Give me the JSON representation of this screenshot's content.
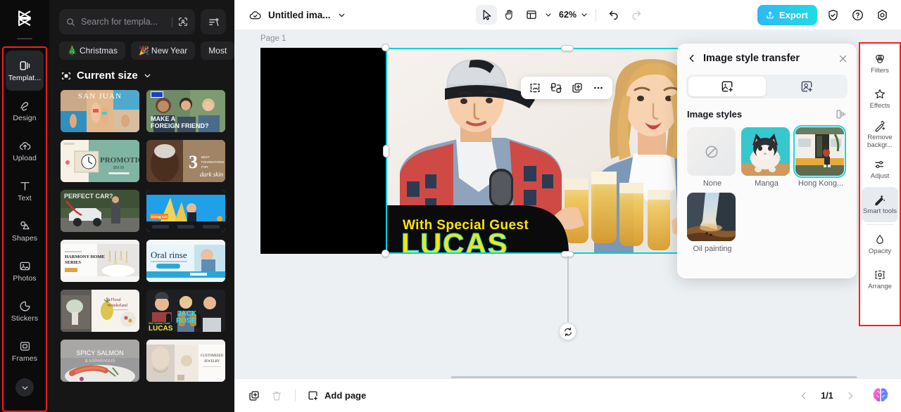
{
  "app": {
    "logo_icon": "capcut-logo-icon"
  },
  "left_rail": {
    "items": [
      {
        "label": "Templat...",
        "icon": "templates-icon",
        "active": true
      },
      {
        "label": "Design",
        "icon": "design-icon",
        "active": false
      },
      {
        "label": "Upload",
        "icon": "upload-cloud-icon",
        "active": false
      },
      {
        "label": "Text",
        "icon": "text-icon",
        "active": false
      },
      {
        "label": "Shapes",
        "icon": "shapes-icon",
        "active": false
      },
      {
        "label": "Photos",
        "icon": "photos-icon",
        "active": false
      },
      {
        "label": "Stickers",
        "icon": "stickers-icon",
        "active": false
      },
      {
        "label": "Frames",
        "icon": "frames-icon",
        "active": false
      }
    ],
    "more_icon": "chevron-down-icon",
    "highlight_color": "#ff1a1a"
  },
  "templates_panel": {
    "search": {
      "placeholder": "Search for templa...",
      "search_icon": "search-icon",
      "image_search_icon": "image-search-icon"
    },
    "filter_icon": "filter-icon",
    "chips": [
      {
        "emoji": "🎄",
        "label": "Christmas"
      },
      {
        "emoji": "🎉",
        "label": "New Year"
      },
      {
        "emoji": "",
        "label": "Most"
      }
    ],
    "current_size": {
      "label": "Current size",
      "icon": "frame-size-icon",
      "chevron": "chevron-down-icon"
    },
    "thumbnails": [
      {
        "title": "SAN JUAN",
        "kind": "beach-collage"
      },
      {
        "title": "MAKE A FOREIGN FRIEND?",
        "kind": "people-photo"
      },
      {
        "title": "PROMOTION",
        "kind": "promo-green"
      },
      {
        "title": "3 BEST FOUNDATIONS FOR dark skin",
        "kind": "beauty-brown"
      },
      {
        "title": "PERFECT CAR?",
        "kind": "car-photo"
      },
      {
        "title": "Diving suit",
        "kind": "web-blue"
      },
      {
        "title": "HARMONY HOME SERIES",
        "kind": "home-white"
      },
      {
        "title": "Oral rinse",
        "kind": "web-cyan"
      },
      {
        "title": "A Floral Wonderland",
        "kind": "floral-beige"
      },
      {
        "title": "JACK ROSE LUCAS",
        "kind": "podcast-dark"
      },
      {
        "title": "SPICY SALMON & ASPARAGUS",
        "kind": "food-gray"
      },
      {
        "title": "CUSTOMIZED JEWELRY",
        "kind": "jewelry-white"
      }
    ],
    "collapse_icon": "chevron-left-icon"
  },
  "topbar": {
    "cloud_icon": "cloud-saved-icon",
    "doc_name": "Untitled ima...",
    "doc_chevron": "chevron-down-icon",
    "tools": [
      {
        "name": "select",
        "icon": "cursor-arrow-icon",
        "selected": true
      },
      {
        "name": "hand",
        "icon": "hand-icon",
        "selected": false
      },
      {
        "name": "layout",
        "icon": "layout-icon",
        "selected": false
      }
    ],
    "layout_chevron": "chevron-down-icon",
    "zoom_value": "62%",
    "zoom_chevron": "chevron-down-icon",
    "undo_icon": "undo-icon",
    "redo_icon": "redo-icon",
    "export_label": "Export",
    "export_icon": "export-upload-icon",
    "export_color": "#2fb8f5",
    "shield_icon": "shield-check-icon",
    "help_icon": "help-question-icon",
    "settings_icon": "settings-gear-icon"
  },
  "canvas": {
    "page_label": "Page 1",
    "selection_color": "#00d1e0",
    "rotate_icon": "rotate-icon",
    "float_toolbar": [
      {
        "name": "crop",
        "icon": "crop-image-icon"
      },
      {
        "name": "replace",
        "icon": "replace-swap-icon"
      },
      {
        "name": "duplicate",
        "icon": "duplicate-icon"
      },
      {
        "name": "more",
        "icon": "more-dots-icon"
      }
    ],
    "artwork": {
      "headline_small": "With Special Guest",
      "headline_big": "LUCAS",
      "small_color": "#ffe600",
      "big_color": "#ffe600"
    }
  },
  "style_panel": {
    "back_icon": "chevron-left-icon",
    "title": "Image style transfer",
    "close_icon": "close-icon",
    "tabs": [
      {
        "name": "image-style",
        "icon": "image-style-icon",
        "active": true
      },
      {
        "name": "portrait-style",
        "icon": "portrait-style-icon",
        "active": false
      }
    ],
    "section_title": "Image styles",
    "section_action_icon": "compare-icon",
    "styles": [
      {
        "label": "None",
        "kind": "none",
        "selected": false
      },
      {
        "label": "Manga",
        "kind": "cat-teal",
        "selected": false
      },
      {
        "label": "Hong Kong...",
        "kind": "van-street",
        "selected": true
      },
      {
        "label": "Oil painting",
        "kind": "canyon",
        "selected": false
      }
    ]
  },
  "right_rail": {
    "highlight_color": "#ff1a1a",
    "items": [
      {
        "label": "Filters",
        "icon": "filters-icon",
        "active": false
      },
      {
        "label": "Effects",
        "icon": "effects-icon",
        "active": false
      },
      {
        "label": "Remove backgr...",
        "icon": "remove-background-icon",
        "active": false
      },
      {
        "label": "Adjust",
        "icon": "adjust-sliders-icon",
        "active": false
      },
      {
        "label": "Smart tools",
        "icon": "smart-tools-icon",
        "active": true
      },
      {
        "label": "Opacity",
        "icon": "opacity-drop-icon",
        "active": false
      },
      {
        "label": "Arrange",
        "icon": "arrange-icon",
        "active": false
      }
    ]
  },
  "bottombar": {
    "duplicate_icon": "duplicate-page-icon",
    "delete_icon": "trash-icon",
    "add_page_label": "Add page",
    "add_page_icon": "add-page-icon",
    "prev_icon": "chevron-left-icon",
    "page_indicator": "1/1",
    "next_icon": "chevron-right-icon",
    "ai_icon": "ai-brain-icon"
  }
}
